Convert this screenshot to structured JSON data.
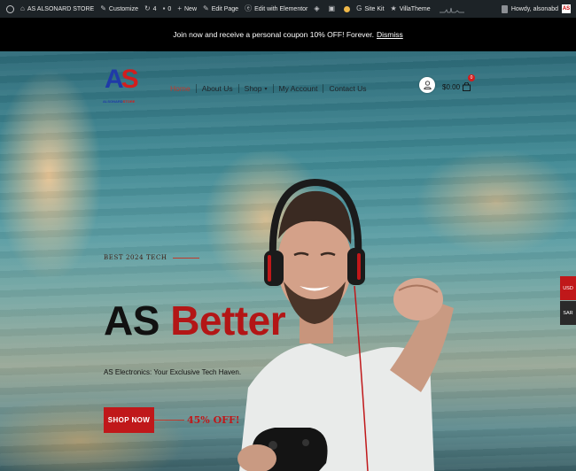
{
  "admin_bar": {
    "site_name": "AS ALSONARD STORE",
    "customize": "Customize",
    "updates_count": "4",
    "comments_count": "0",
    "new": "New",
    "edit_page": "Edit Page",
    "edit_elementor": "Edit with Elementor",
    "site_kit": "Site Kit",
    "villatheme": "VillaTheme",
    "howdy": "Howdy, alsonabd",
    "avatar_label": "AS"
  },
  "notice": {
    "text": "Join now and receive a personal coupon 10% OFF! Forever.",
    "dismiss": "Dismiss"
  },
  "header": {
    "logo_letters": [
      "A",
      "S"
    ],
    "logo_tag_1": "ALSONARD",
    "logo_tag_2": "STORE",
    "nav": [
      "Home",
      "About Us",
      "Shop",
      "My Account",
      "Contact Us"
    ],
    "cart_total": "$0.00",
    "cart_count": "0"
  },
  "hero": {
    "eyebrow": "BEST 2024 TECH",
    "headline_1": "AS",
    "headline_2": "Better",
    "subtitle": "AS Electronics: Your Exclusive Tech Haven.",
    "cta": "SHOP NOW",
    "promo": "45% OFF!"
  },
  "currency": [
    "USD",
    "SAR"
  ],
  "colors": {
    "accent_red": "#c0181a",
    "logo_blue": "#1f3aa8",
    "admin_bar": "#1d2327"
  }
}
